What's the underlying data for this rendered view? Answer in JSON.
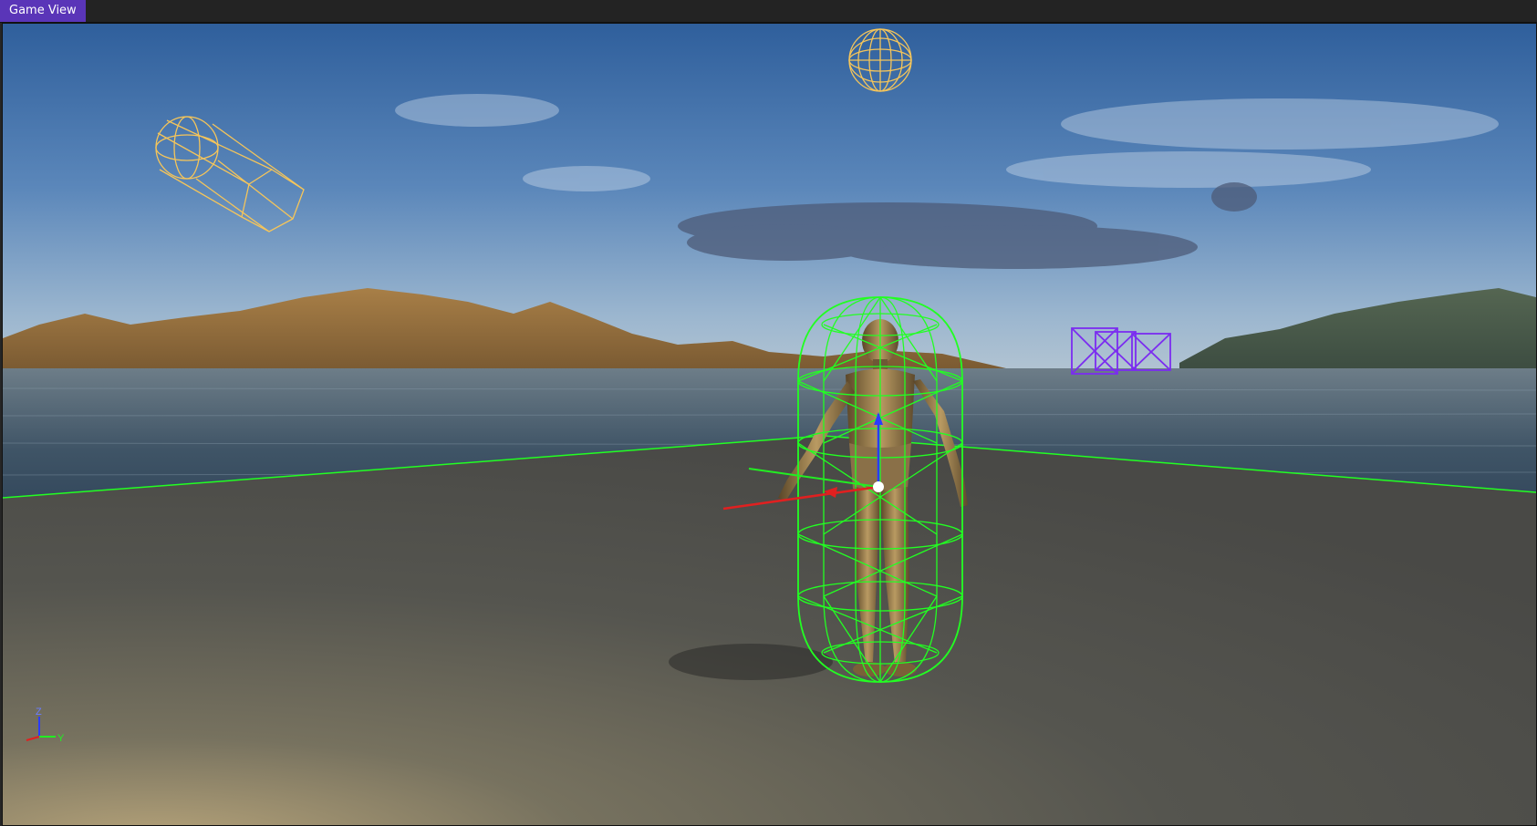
{
  "panel": {
    "tab_label": "Game View"
  },
  "axis_gizmo": {
    "z_label": "Z",
    "y_label": "Y"
  },
  "colors": {
    "tab_active": "#5a35b8",
    "collision_wireframe": "#22ff22",
    "light_gizmo": "#f5c55a",
    "camera_gizmo": "#7b2cf0",
    "axis_x": "#e02020",
    "axis_y": "#22ee22",
    "axis_z": "#2a3cff"
  },
  "scene_objects": [
    {
      "name": "character",
      "icon": "mannequin-figure"
    },
    {
      "name": "capsule-collider",
      "icon": "green-wireframe-capsule"
    },
    {
      "name": "point-light",
      "icon": "yellow-wire-sphere"
    },
    {
      "name": "spot-light",
      "icon": "yellow-wire-cylinder"
    },
    {
      "name": "camera",
      "icon": "purple-wire-boxes"
    },
    {
      "name": "ground-plane",
      "icon": "green-plane-outline"
    }
  ]
}
